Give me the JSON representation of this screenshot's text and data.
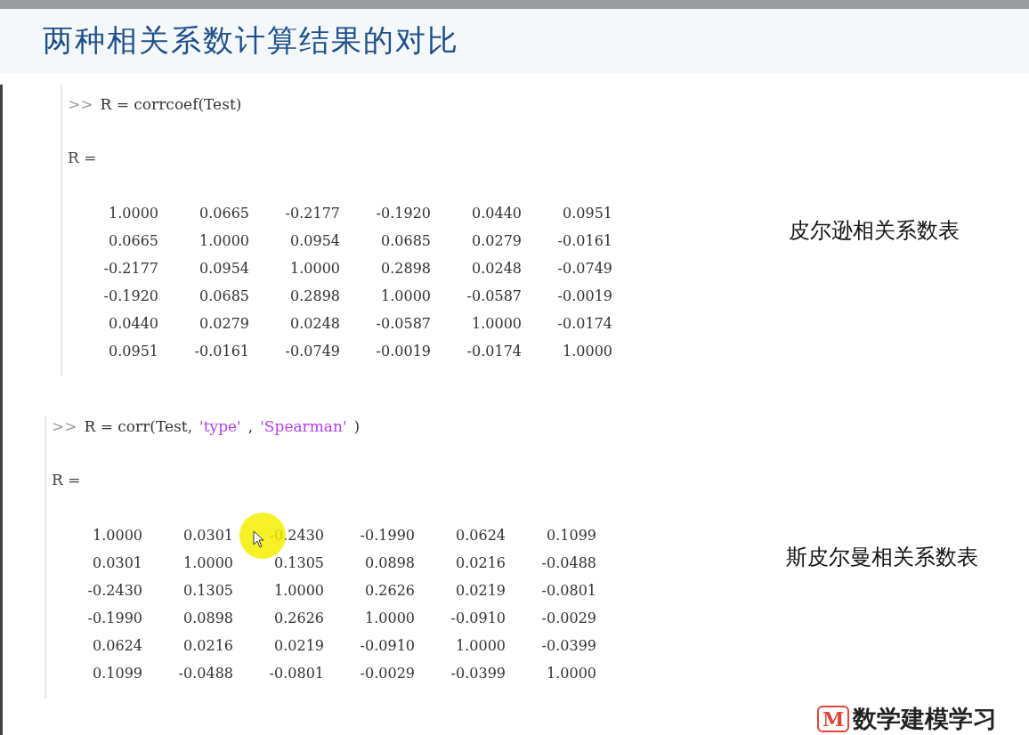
{
  "title": "两种相关系数计算结果的对比",
  "blocks": [
    {
      "command": [
        {
          "kind": "prompt",
          "text": ">>"
        },
        {
          "kind": "code",
          "text": "R = corrcoef(Test)"
        }
      ],
      "result": "R =",
      "caption": "皮尔逊相关系数表",
      "rows": [
        [
          "1.0000",
          "0.0665",
          "-0.2177",
          "-0.1920",
          "0.0440",
          "0.0951"
        ],
        [
          "0.0665",
          "1.0000",
          "0.0954",
          "0.0685",
          "0.0279",
          "-0.0161"
        ],
        [
          "-0.2177",
          "0.0954",
          "1.0000",
          "0.2898",
          "0.0248",
          "-0.0749"
        ],
        [
          "-0.1920",
          "0.0685",
          "0.2898",
          "1.0000",
          "-0.0587",
          "-0.0019"
        ],
        [
          "0.0440",
          "0.0279",
          "0.0248",
          "-0.0587",
          "1.0000",
          "-0.0174"
        ],
        [
          "0.0951",
          "-0.0161",
          "-0.0749",
          "-0.0019",
          "-0.0174",
          "1.0000"
        ]
      ]
    },
    {
      "command": [
        {
          "kind": "prompt",
          "text": ">>"
        },
        {
          "kind": "code",
          "text": "R = corr(Test,"
        },
        {
          "kind": "string",
          "text": "'type'"
        },
        {
          "kind": "code",
          "text": ","
        },
        {
          "kind": "string",
          "text": "'Spearman'"
        },
        {
          "kind": "code",
          "text": ")"
        }
      ],
      "result": "R =",
      "caption": "斯皮尔曼相关系数表",
      "rows": [
        [
          "1.0000",
          "0.0301",
          "-0.2430",
          "-0.1990",
          "0.0624",
          "0.1099"
        ],
        [
          "0.0301",
          "1.0000",
          "0.1305",
          "0.0898",
          "0.0216",
          "-0.0488"
        ],
        [
          "-0.2430",
          "0.1305",
          "1.0000",
          "0.2626",
          "0.0219",
          "-0.0801"
        ],
        [
          "-0.1990",
          "0.0898",
          "0.2626",
          "1.0000",
          "-0.0910",
          "-0.0029"
        ],
        [
          "0.0624",
          "0.0216",
          "0.0219",
          "-0.0910",
          "1.0000",
          "-0.0399"
        ],
        [
          "0.1099",
          "-0.0488",
          "-0.0801",
          "-0.0029",
          "-0.0399",
          "1.0000"
        ]
      ]
    }
  ],
  "logo": {
    "mark": "M",
    "text": "数学建模学习"
  }
}
